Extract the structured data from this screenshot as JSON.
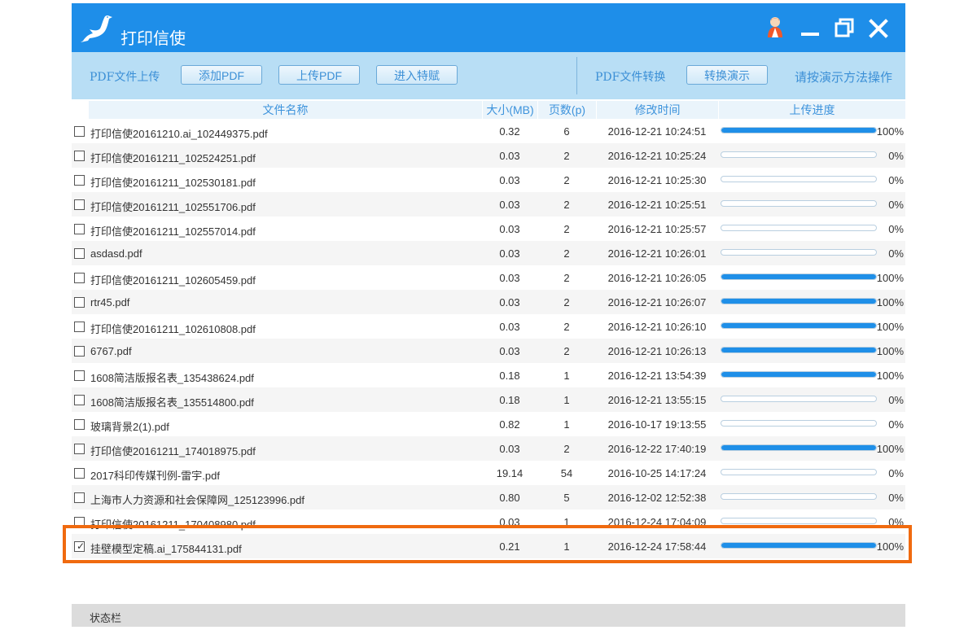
{
  "app": {
    "title": "打印信使",
    "logo_icon": "pigeon-icon",
    "controls": [
      "user-avatar-icon",
      "minimize-icon",
      "restore-icon",
      "close-icon"
    ],
    "accent_color": "#1e8ee9"
  },
  "toolbar": {
    "upload_label": "PDF文件上传",
    "add_pdf": "添加PDF",
    "upload_pdf": "上传PDF",
    "enter_special": "进入特赋",
    "convert_label": "PDF文件转换",
    "convert_demo": "转换演示",
    "hint": "请按演示方法操作"
  },
  "table": {
    "headers": {
      "name": "文件名称",
      "size": "大小(MB)",
      "pages": "页数(p)",
      "time": "修改时间",
      "progress": "上传进度"
    },
    "rows": [
      {
        "checked": false,
        "name": "打印信使20161210.ai_102449375.pdf",
        "size": "0.32",
        "pages": "6",
        "time": "2016-12-21 10:24:51",
        "progress": 100,
        "pct": "100%"
      },
      {
        "checked": false,
        "name": "打印信使20161211_102524251.pdf",
        "size": "0.03",
        "pages": "2",
        "time": "2016-12-21 10:25:24",
        "progress": 0,
        "pct": "0%"
      },
      {
        "checked": false,
        "name": "打印信使20161211_102530181.pdf",
        "size": "0.03",
        "pages": "2",
        "time": "2016-12-21 10:25:30",
        "progress": 0,
        "pct": "0%"
      },
      {
        "checked": false,
        "name": "打印信使20161211_102551706.pdf",
        "size": "0.03",
        "pages": "2",
        "time": "2016-12-21 10:25:51",
        "progress": 0,
        "pct": "0%"
      },
      {
        "checked": false,
        "name": "打印信使20161211_102557014.pdf",
        "size": "0.03",
        "pages": "2",
        "time": "2016-12-21 10:25:57",
        "progress": 0,
        "pct": "0%"
      },
      {
        "checked": false,
        "name": "asdasd.pdf",
        "size": "0.03",
        "pages": "2",
        "time": "2016-12-21 10:26:01",
        "progress": 0,
        "pct": "0%"
      },
      {
        "checked": false,
        "name": "打印信使20161211_102605459.pdf",
        "size": "0.03",
        "pages": "2",
        "time": "2016-12-21 10:26:05",
        "progress": 100,
        "pct": "100%"
      },
      {
        "checked": false,
        "name": "rtr45.pdf",
        "size": "0.03",
        "pages": "2",
        "time": "2016-12-21 10:26:07",
        "progress": 100,
        "pct": "100%"
      },
      {
        "checked": false,
        "name": "打印信使20161211_102610808.pdf",
        "size": "0.03",
        "pages": "2",
        "time": "2016-12-21 10:26:10",
        "progress": 100,
        "pct": "100%"
      },
      {
        "checked": false,
        "name": "6767.pdf",
        "size": "0.03",
        "pages": "2",
        "time": "2016-12-21 10:26:13",
        "progress": 100,
        "pct": "100%"
      },
      {
        "checked": false,
        "name": "1608简洁版报名表_135438624.pdf",
        "size": "0.18",
        "pages": "1",
        "time": "2016-12-21 13:54:39",
        "progress": 100,
        "pct": "100%"
      },
      {
        "checked": false,
        "name": "1608简洁版报名表_135514800.pdf",
        "size": "0.18",
        "pages": "1",
        "time": "2016-12-21 13:55:15",
        "progress": 0,
        "pct": "0%"
      },
      {
        "checked": false,
        "name": "玻璃背景2(1).pdf",
        "size": "0.82",
        "pages": "1",
        "time": "2016-10-17 19:13:55",
        "progress": 0,
        "pct": "0%"
      },
      {
        "checked": false,
        "name": "打印信使20161211_174018975.pdf",
        "size": "0.03",
        "pages": "2",
        "time": "2016-12-22 17:40:19",
        "progress": 100,
        "pct": "100%"
      },
      {
        "checked": false,
        "name": "2017科印传媒刊例-雷宇.pdf",
        "size": "19.14",
        "pages": "54",
        "time": "2016-10-25 14:17:24",
        "progress": 0,
        "pct": "0%"
      },
      {
        "checked": false,
        "name": "上海市人力资源和社会保障网_125123996.pdf",
        "size": "0.80",
        "pages": "5",
        "time": "2016-12-02 12:52:38",
        "progress": 0,
        "pct": "0%"
      },
      {
        "checked": false,
        "name": "打印信使20161211_170408980.pdf",
        "size": "0.03",
        "pages": "1",
        "time": "2016-12-24 17:04:09",
        "progress": 0,
        "pct": "0%"
      },
      {
        "checked": true,
        "name": "挂壁模型定稿.ai_175844131.pdf",
        "size": "0.21",
        "pages": "1",
        "time": "2016-12-24 17:58:44",
        "progress": 100,
        "pct": "100%"
      }
    ]
  },
  "highlight_color": "#f06a0f",
  "status": {
    "text": "状态栏"
  }
}
